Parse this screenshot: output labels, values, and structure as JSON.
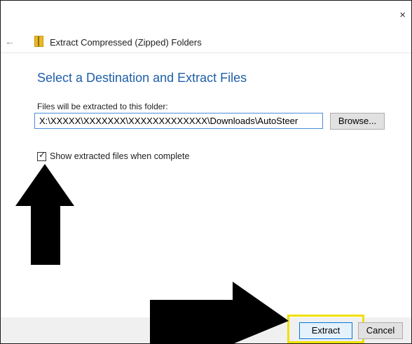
{
  "window": {
    "title": "Extract Compressed (Zipped) Folders",
    "close_glyph": "×",
    "back_glyph": "←"
  },
  "main": {
    "heading": "Select a Destination and Extract Files",
    "files_label": "Files will be extracted to this folder:",
    "path_value": "X:\\XXXXX\\XXXXXXX\\XXXXXXXXXXXXX\\Downloads\\AutoSteer",
    "browse_label": "Browse...",
    "show_files_label": "Show extracted files when complete",
    "show_files_checked": true,
    "check_glyph": "✓"
  },
  "footer": {
    "extract_label": "Extract",
    "cancel_label": "Cancel"
  },
  "colors": {
    "heading": "#1f5fa8",
    "highlight": "#f0e000",
    "annotation_arrow": "#000000"
  },
  "icons": {
    "zip_folder": "zip-folder-icon",
    "back": "back-arrow-icon",
    "close": "close-icon"
  }
}
